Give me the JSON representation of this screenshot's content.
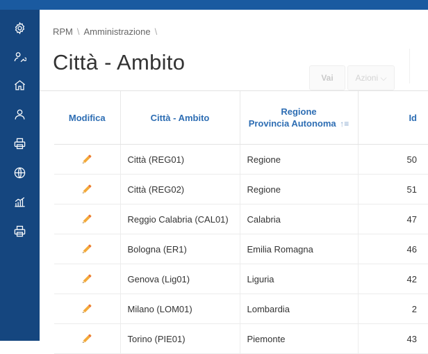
{
  "breadcrumb": {
    "root": "RPM",
    "section": "Amministrazione"
  },
  "page": {
    "title": "Città - Ambito"
  },
  "toolbar": {
    "go_label": "Vai",
    "actions_label": "Azioni ⌵"
  },
  "sidebar": {
    "icons": [
      "gear-icon",
      "user-wrench-icon",
      "home-icon",
      "user-icon",
      "printer-icon",
      "globe-icon",
      "bar-chart-icon",
      "printer-icon"
    ]
  },
  "table": {
    "columns": {
      "edit": "Modifica",
      "city": "Città - Ambito",
      "region_line1": "Regione",
      "region_line2": "Provincia Autonoma",
      "region_sort": "↑≡",
      "id": "Id"
    },
    "rows": [
      {
        "city": "Città (REG01)",
        "region": "Regione",
        "id": "50"
      },
      {
        "city": "Città (REG02)",
        "region": "Regione",
        "id": "51"
      },
      {
        "city": "Reggio Calabria (CAL01)",
        "region": "Calabria",
        "id": "47"
      },
      {
        "city": "Bologna (ER1)",
        "region": "Emilia Romagna",
        "id": "46"
      },
      {
        "city": "Genova (Lig01)",
        "region": "Liguria",
        "id": "42"
      },
      {
        "city": "Milano (LOM01)",
        "region": "Lombardia",
        "id": "2"
      },
      {
        "city": "Torino (PIE01)",
        "region": "Piemonte",
        "id": "43"
      }
    ]
  },
  "colors": {
    "sidebar": "#15467f",
    "topbar": "#1a5aa0",
    "header_text": "#2d6db3",
    "pencil": "#f0a830"
  }
}
